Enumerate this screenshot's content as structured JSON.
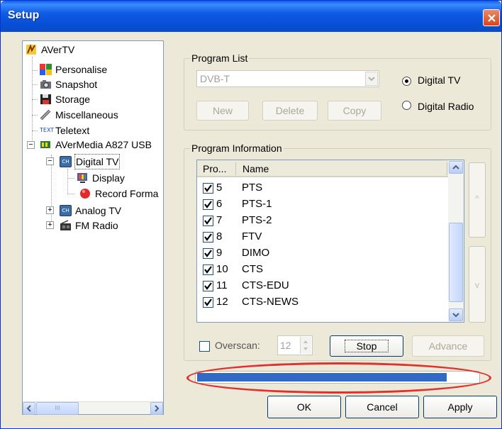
{
  "window": {
    "title": "Setup"
  },
  "tree": {
    "items": [
      {
        "label": "AVerTV",
        "icon": "avertv-icon"
      },
      {
        "label": "Personalise",
        "icon": "personalise-icon"
      },
      {
        "label": "Snapshot",
        "icon": "camera-icon"
      },
      {
        "label": "Storage",
        "icon": "floppy-disk-icon"
      },
      {
        "label": "Miscellaneous",
        "icon": "tools-icon"
      },
      {
        "label": "Teletext",
        "icon": "teletext-icon",
        "icon_text": "TEXT"
      },
      {
        "label": "AVerMedia A827 USB",
        "icon": "tv-device-icon"
      },
      {
        "label": "Digital TV",
        "icon": "channel-icon",
        "icon_text": "CH"
      },
      {
        "label": "Display",
        "icon": "display-icon"
      },
      {
        "label": "Record Forma",
        "icon": "record-icon"
      },
      {
        "label": "Analog TV",
        "icon": "channel-icon",
        "icon_text": "CH"
      },
      {
        "label": "FM Radio",
        "icon": "radio-icon"
      }
    ],
    "scroll_thumb_text": "III"
  },
  "program_list": {
    "title": "Program List",
    "combo_value": "DVB-T",
    "radios": [
      {
        "label": "Digital TV",
        "selected": true
      },
      {
        "label": "Digital Radio",
        "selected": false
      }
    ],
    "buttons": {
      "new": "New",
      "delete": "Delete",
      "copy": "Copy"
    }
  },
  "program_information": {
    "title": "Program Information",
    "columns": [
      "Pro...",
      "Name"
    ],
    "rows": [
      {
        "num": "5",
        "name": "PTS",
        "checked": true
      },
      {
        "num": "6",
        "name": "PTS-1",
        "checked": true
      },
      {
        "num": "7",
        "name": "PTS-2",
        "checked": true
      },
      {
        "num": "8",
        "name": "FTV",
        "checked": true
      },
      {
        "num": "9",
        "name": "DIMO",
        "checked": true
      },
      {
        "num": "10",
        "name": "CTS",
        "checked": true
      },
      {
        "num": "11",
        "name": "CTS-EDU",
        "checked": true
      },
      {
        "num": "12",
        "name": "CTS-NEWS",
        "checked": true
      }
    ],
    "move_up": "^",
    "move_down": "v",
    "overscan_label": "Overscan:",
    "overscan_value": "12",
    "stop_label": "Stop",
    "advance_label": "Advance"
  },
  "scan_progress": {
    "fraction": 0.89
  },
  "footer": {
    "ok": "OK",
    "cancel": "Cancel",
    "apply": "Apply"
  },
  "colors": {
    "progress": "#316ac5",
    "highlight": "#e03030",
    "titlebar": "#0a5fe6"
  }
}
